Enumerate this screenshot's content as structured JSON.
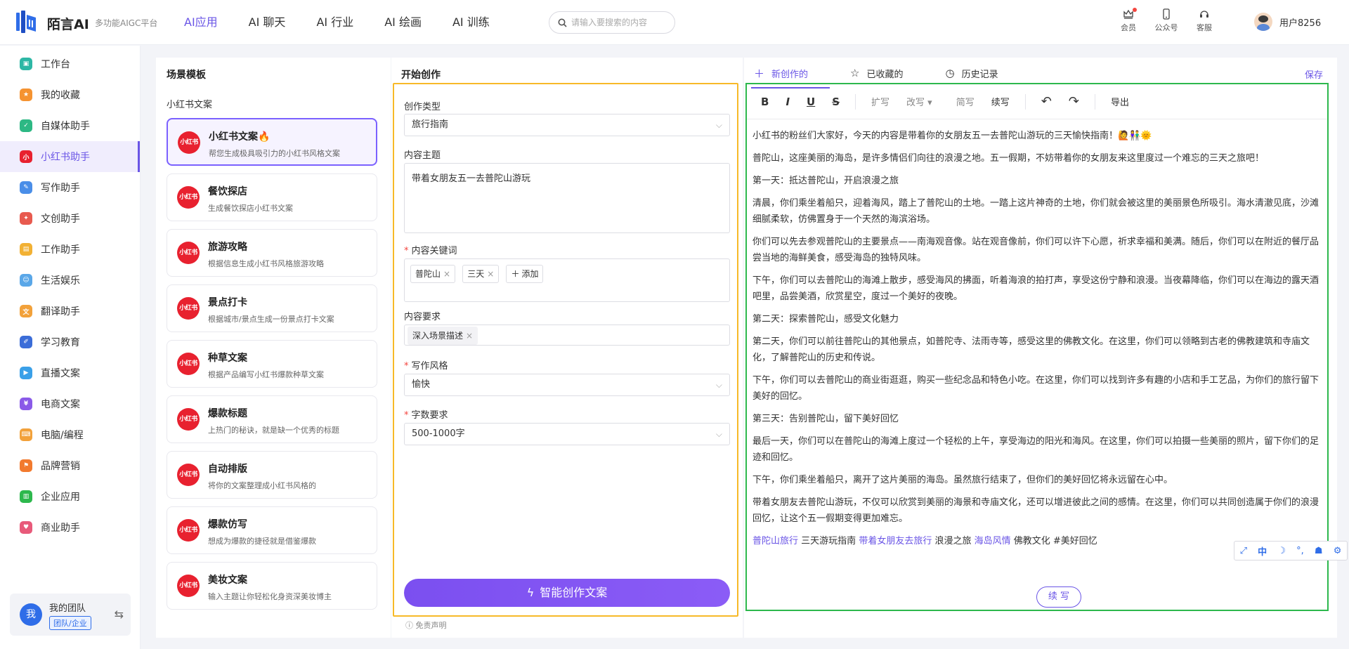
{
  "header": {
    "logo": "陌言AI",
    "subtitle": "多功能AIGC平台",
    "nav": [
      "AI应用",
      "AI 聊天",
      "AI 行业",
      "AI 绘画",
      "AI 训练"
    ],
    "search_placeholder": "请输入要搜索的内容",
    "icons": [
      {
        "label": "会员",
        "icon": "crown-icon"
      },
      {
        "label": "公众号",
        "icon": "phone-icon"
      },
      {
        "label": "客服",
        "icon": "headset-icon"
      }
    ],
    "user": "用户8256"
  },
  "sidebar": {
    "items": [
      {
        "label": "工作台",
        "color": "#2db7a5",
        "glyph": "▣"
      },
      {
        "label": "我的收藏",
        "color": "#f59331",
        "glyph": "★"
      },
      {
        "label": "自媒体助手",
        "color": "#2db884",
        "glyph": "✓"
      },
      {
        "label": "小红书助手",
        "color": "#e8212f",
        "glyph": "小"
      },
      {
        "label": "写作助手",
        "color": "#4a8ee8",
        "glyph": "✎"
      },
      {
        "label": "文创助手",
        "color": "#e85a4f",
        "glyph": "✦"
      },
      {
        "label": "工作助手",
        "color": "#f2b134",
        "glyph": "▤"
      },
      {
        "label": "生活娱乐",
        "color": "#5aa7e8",
        "glyph": "☺"
      },
      {
        "label": "翻译助手",
        "color": "#f2a13a",
        "glyph": "文"
      },
      {
        "label": "学习教育",
        "color": "#3b6dd8",
        "glyph": "✐"
      },
      {
        "label": "直播文案",
        "color": "#3aa0e8",
        "glyph": "▶"
      },
      {
        "label": "电商文案",
        "color": "#8a5ae8",
        "glyph": "¥"
      },
      {
        "label": "电脑/编程",
        "color": "#f2a13a",
        "glyph": "⌨"
      },
      {
        "label": "品牌营销",
        "color": "#f27a2e",
        "glyph": "⚑"
      },
      {
        "label": "企业应用",
        "color": "#2db84d",
        "glyph": "▥"
      },
      {
        "label": "商业助手",
        "color": "#e85a7a",
        "glyph": "♥"
      }
    ],
    "active_index": 3,
    "team": {
      "avatar": "我",
      "name": "我的团队",
      "badge": "团队/企业"
    }
  },
  "templates": {
    "title": "场景模板",
    "subtitle": "小红书文案",
    "badge": "小红书",
    "cards": [
      {
        "title": "小红书文案🔥",
        "desc": "帮您生成极具吸引力的小红书风格文案"
      },
      {
        "title": "餐饮探店",
        "desc": "生成餐饮探店小红书文案"
      },
      {
        "title": "旅游攻略",
        "desc": "根据信息生成小红书风格旅游攻略"
      },
      {
        "title": "景点打卡",
        "desc": "根据城市/景点生成一份景点打卡文案"
      },
      {
        "title": "种草文案",
        "desc": "根据产品编写小红书爆款种草文案"
      },
      {
        "title": "爆款标题",
        "desc": "上热门的秘诀，就是缺一个优秀的标题"
      },
      {
        "title": "自动排版",
        "desc": "将你的文案整理成小红书风格的"
      },
      {
        "title": "爆款仿写",
        "desc": "想成为爆款的捷径就是借鉴爆款"
      },
      {
        "title": "美妆文案",
        "desc": "输入主题让你轻松化身资深美妆博主"
      }
    ]
  },
  "form": {
    "title": "开始创作",
    "type_label": "创作类型",
    "type_value": "旅行指南",
    "topic_label": "内容主题",
    "topic_value": "带着女朋友五一去普陀山游玩",
    "keywords_label": "内容关键词",
    "keywords": [
      "普陀山",
      "三天"
    ],
    "add_label": "添加",
    "req_label": "内容要求",
    "requirements": [
      "深入场景描述"
    ],
    "style_label": "写作风格",
    "style_value": "愉快",
    "words_label": "字数要求",
    "words_value": "500-1000字",
    "submit": "智能创作文案",
    "disclaimer": "免责声明"
  },
  "output": {
    "tabs": [
      "新创作的",
      "已收藏的",
      "历史记录"
    ],
    "save": "保存",
    "toolbar": {
      "format": [
        "B",
        "I",
        "U",
        "S"
      ],
      "actions": [
        "扩写",
        "改写 ▾",
        "简写",
        "续写"
      ],
      "undo": "↶",
      "redo": "↷",
      "export": "导出"
    },
    "paragraphs": [
      "小红书的粉丝们大家好，今天的内容是带着你的女朋友五一去普陀山游玩的三天愉快指南！🙋👫🌞",
      "普陀山，这座美丽的海岛，是许多情侣们向往的浪漫之地。五一假期，不妨带着你的女朋友来这里度过一个难忘的三天之旅吧！",
      "第一天：抵达普陀山，开启浪漫之旅",
      "清晨，你们乘坐着船只，迎着海风，踏上了普陀山的土地。一踏上这片神奇的土地，你们就会被这里的美丽景色所吸引。海水清澈见底，沙滩细腻柔软，仿佛置身于一个天然的海滨浴场。",
      "你们可以先去参观普陀山的主要景点——南海观音像。站在观音像前，你们可以许下心愿，祈求幸福和美满。随后，你们可以在附近的餐厅品尝当地的海鲜美食，感受海岛的独特风味。",
      "下午，你们可以去普陀山的海滩上散步，感受海风的拂面，听着海浪的拍打声，享受这份宁静和浪漫。当夜幕降临，你们可以在海边的露天酒吧里，品尝美酒，欣赏星空，度过一个美好的夜晚。",
      "第二天：探索普陀山，感受文化魅力",
      "第二天，你们可以前往普陀山的其他景点，如普陀寺、法雨寺等，感受这里的佛教文化。在这里，你们可以领略到古老的佛教建筑和寺庙文化，了解普陀山的历史和传说。",
      "下午，你们可以去普陀山的商业街逛逛，购买一些纪念品和特色小吃。在这里，你们可以找到许多有趣的小店和手工艺品，为你们的旅行留下美好的回忆。",
      "第三天：告别普陀山，留下美好回忆",
      "最后一天，你们可以在普陀山的海滩上度过一个轻松的上午，享受海边的阳光和海风。在这里，你们可以拍摄一些美丽的照片，留下你们的足迹和回忆。",
      "下午，你们乘坐着船只，离开了这片美丽的海岛。虽然旅行结束了，但你们的美好回忆将永远留在心中。",
      "带着女朋友去普陀山游玩，不仅可以欣赏到美丽的海景和寺庙文化，还可以增进彼此之间的感情。在这里，你们可以共同创造属于你们的浪漫回忆，让这个五一假期变得更加难忘。"
    ],
    "hashtags": [
      {
        "text": "普陀山旅行",
        "hl": true
      },
      {
        "text": "三天游玩指南",
        "hl": false
      },
      {
        "text": "带着女朋友去旅行",
        "hl": true
      },
      {
        "text": "浪漫之旅",
        "hl": false
      },
      {
        "text": "海岛风情",
        "hl": true
      },
      {
        "text": "佛教文化 #美好回忆",
        "hl": false
      }
    ],
    "continue": "续 写",
    "float_bar": [
      "⤢",
      "中",
      "☽",
      "°,",
      "☗",
      "⚙"
    ]
  }
}
